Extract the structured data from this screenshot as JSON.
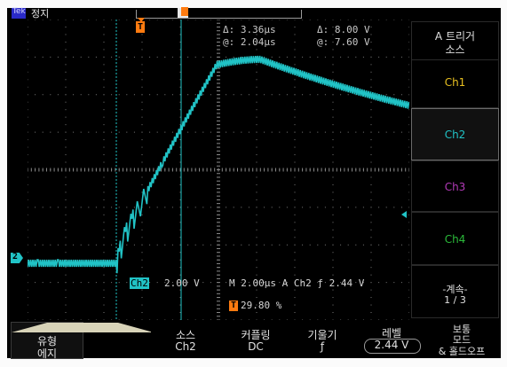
{
  "status": {
    "run_badge": "Tek",
    "run_state": "정지"
  },
  "cursor_readout": {
    "delta_time": "Δ:   3.36μs",
    "at_time": "@:   2.04μs",
    "delta_volt": "Δ:   8.00 V",
    "at_volt": "@:   7.60 V"
  },
  "markers": {
    "trigger_top": "T",
    "trigger_level": "T",
    "channel_ground": "2"
  },
  "scale": {
    "ch2_label": "Ch2",
    "ch2_volts": "2.00 V",
    "timebase": "M 2.00μs A  Ch2 ƒ   2.44 V",
    "trig_pos_icon": "T",
    "trig_pos": "29.80 %"
  },
  "side_menu": {
    "title_line1": "A 트리거",
    "title_line2": "소스",
    "items": [
      "Ch1",
      "Ch2",
      "Ch3",
      "Ch4"
    ],
    "more_line1": "-계속-",
    "more_line2": "1 / 3"
  },
  "bottom_menu": {
    "type_line1": "유형",
    "type_line2": "에지",
    "source_line1": "소스",
    "source_line2": "Ch2",
    "coupling_line1": "커플링",
    "coupling_line2": "DC",
    "slope_line1": "기울기",
    "slope_line2": "ƒ",
    "level_line1": "레벨",
    "level_line2": "2.44 V",
    "mode_line1": "보통",
    "mode_line2": "모드",
    "mode_line3": "& 홀드오프"
  },
  "colors": {
    "ch1": "#e8c020",
    "ch2": "#21c3c6",
    "ch3": "#b23ab8",
    "ch4": "#2bbb3a",
    "trigger": "#ff7b10",
    "menu_text": "#e0e0e0"
  },
  "icons": {
    "slope": "rising-edge-icon",
    "cursor1": "cursor-line-icon"
  }
}
